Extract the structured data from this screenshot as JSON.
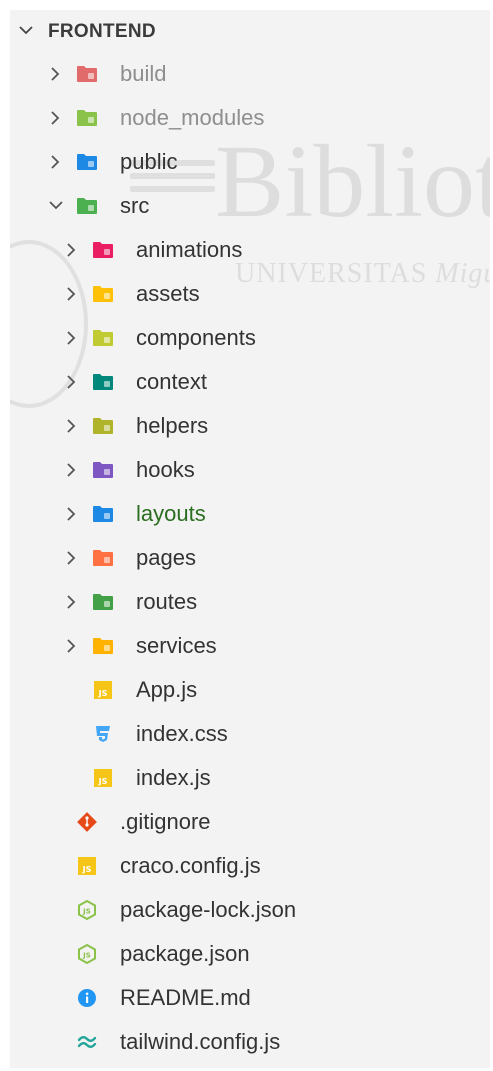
{
  "explorer": {
    "title": "FRONTEND",
    "items": [
      {
        "label": "build",
        "kind": "folder",
        "depth": 0,
        "expanded": false,
        "icon": "folder-build-icon",
        "color": "#e16b6b",
        "style": "dim"
      },
      {
        "label": "node_modules",
        "kind": "folder",
        "depth": 0,
        "expanded": false,
        "icon": "folder-node-icon",
        "color": "#8bc34a",
        "style": "dim"
      },
      {
        "label": "public",
        "kind": "folder",
        "depth": 0,
        "expanded": false,
        "icon": "folder-public-icon",
        "color": "#1e88e5",
        "style": "normal"
      },
      {
        "label": "src",
        "kind": "folder",
        "depth": 0,
        "expanded": true,
        "icon": "folder-src-icon",
        "color": "#4caf50",
        "style": "normal"
      },
      {
        "label": "animations",
        "kind": "folder",
        "depth": 1,
        "expanded": false,
        "icon": "folder-animations-icon",
        "color": "#e91e63",
        "style": "normal"
      },
      {
        "label": "assets",
        "kind": "folder",
        "depth": 1,
        "expanded": false,
        "icon": "folder-assets-icon",
        "color": "#ffc107",
        "style": "normal"
      },
      {
        "label": "components",
        "kind": "folder",
        "depth": 1,
        "expanded": false,
        "icon": "folder-components-icon",
        "color": "#c0ca33",
        "style": "normal"
      },
      {
        "label": "context",
        "kind": "folder",
        "depth": 1,
        "expanded": false,
        "icon": "folder-context-icon",
        "color": "#00897b",
        "style": "normal"
      },
      {
        "label": "helpers",
        "kind": "folder",
        "depth": 1,
        "expanded": false,
        "icon": "folder-helpers-icon",
        "color": "#afb42b",
        "style": "normal"
      },
      {
        "label": "hooks",
        "kind": "folder",
        "depth": 1,
        "expanded": false,
        "icon": "folder-hooks-icon",
        "color": "#7e57c2",
        "style": "normal"
      },
      {
        "label": "layouts",
        "kind": "folder",
        "depth": 1,
        "expanded": false,
        "icon": "folder-layouts-icon",
        "color": "#1e88e5",
        "style": "green"
      },
      {
        "label": "pages",
        "kind": "folder",
        "depth": 1,
        "expanded": false,
        "icon": "folder-pages-icon",
        "color": "#ff7043",
        "style": "normal"
      },
      {
        "label": "routes",
        "kind": "folder",
        "depth": 1,
        "expanded": false,
        "icon": "folder-routes-icon",
        "color": "#43a047",
        "style": "normal"
      },
      {
        "label": "services",
        "kind": "folder",
        "depth": 1,
        "expanded": false,
        "icon": "folder-services-icon",
        "color": "#ffb300",
        "style": "normal"
      },
      {
        "label": "App.js",
        "kind": "file",
        "depth": 1,
        "icon": "javascript-icon",
        "color": "#f5c518",
        "style": "normal"
      },
      {
        "label": "index.css",
        "kind": "file",
        "depth": 1,
        "icon": "css-icon",
        "color": "#42a5f5",
        "style": "normal"
      },
      {
        "label": "index.js",
        "kind": "file",
        "depth": 1,
        "icon": "javascript-icon",
        "color": "#f5c518",
        "style": "normal"
      },
      {
        "label": ".gitignore",
        "kind": "file",
        "depth": 0,
        "icon": "git-icon",
        "color": "#e64a19",
        "style": "normal"
      },
      {
        "label": "craco.config.js",
        "kind": "file",
        "depth": 0,
        "icon": "javascript-icon",
        "color": "#f5c518",
        "style": "normal"
      },
      {
        "label": "package-lock.json",
        "kind": "file",
        "depth": 0,
        "icon": "nodejs-icon",
        "color": "#8bc34a",
        "style": "normal"
      },
      {
        "label": "package.json",
        "kind": "file",
        "depth": 0,
        "icon": "nodejs-icon",
        "color": "#8bc34a",
        "style": "normal"
      },
      {
        "label": "README.md",
        "kind": "file",
        "depth": 0,
        "icon": "info-icon",
        "color": "#2196f3",
        "style": "normal"
      },
      {
        "label": "tailwind.config.js",
        "kind": "file",
        "depth": 0,
        "icon": "tailwind-icon",
        "color": "#26a69a",
        "style": "normal"
      }
    ]
  },
  "watermark": {
    "main": "Bibliote",
    "sub_prefix": "UNIVERSITAS",
    "sub_italic": "Miguel He"
  }
}
